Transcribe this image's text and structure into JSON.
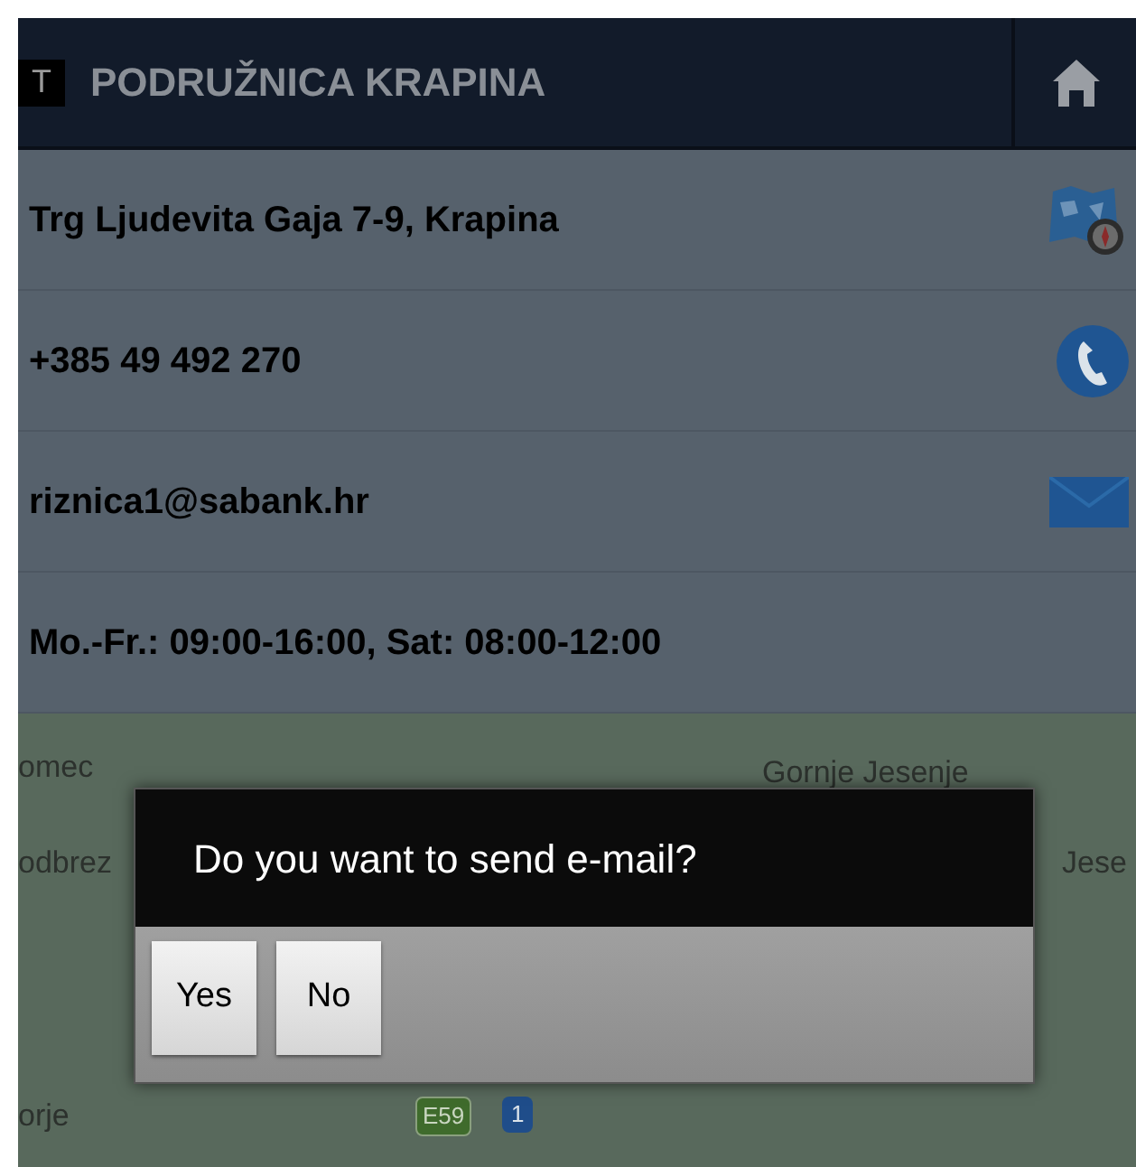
{
  "header": {
    "logo_letter": "T",
    "title": "PODRUŽNICA KRAPINA"
  },
  "contacts": [
    {
      "kind": "address",
      "text": "Trg Ljudevita Gaja 7-9, Krapina"
    },
    {
      "kind": "phone",
      "text": "+385 49 492 270"
    },
    {
      "kind": "email",
      "text": "riznica1@sabank.hr"
    },
    {
      "kind": "hours",
      "text": "Mo.-Fr.: 09:00-16:00, Sat: 08:00-12:00"
    }
  ],
  "map": {
    "labels": [
      {
        "kind": "place",
        "text": "omec"
      },
      {
        "kind": "place",
        "text": "Gornje Jesenje"
      },
      {
        "kind": "place",
        "text": "odbrez"
      },
      {
        "kind": "place",
        "text": "Jese"
      },
      {
        "kind": "place",
        "text": "orje"
      },
      {
        "kind": "road",
        "text": "E59"
      },
      {
        "kind": "route",
        "text": "1"
      }
    ]
  },
  "dialog": {
    "message": "Do you want to send e-mail?",
    "buttons": [
      "Yes",
      "No"
    ]
  }
}
